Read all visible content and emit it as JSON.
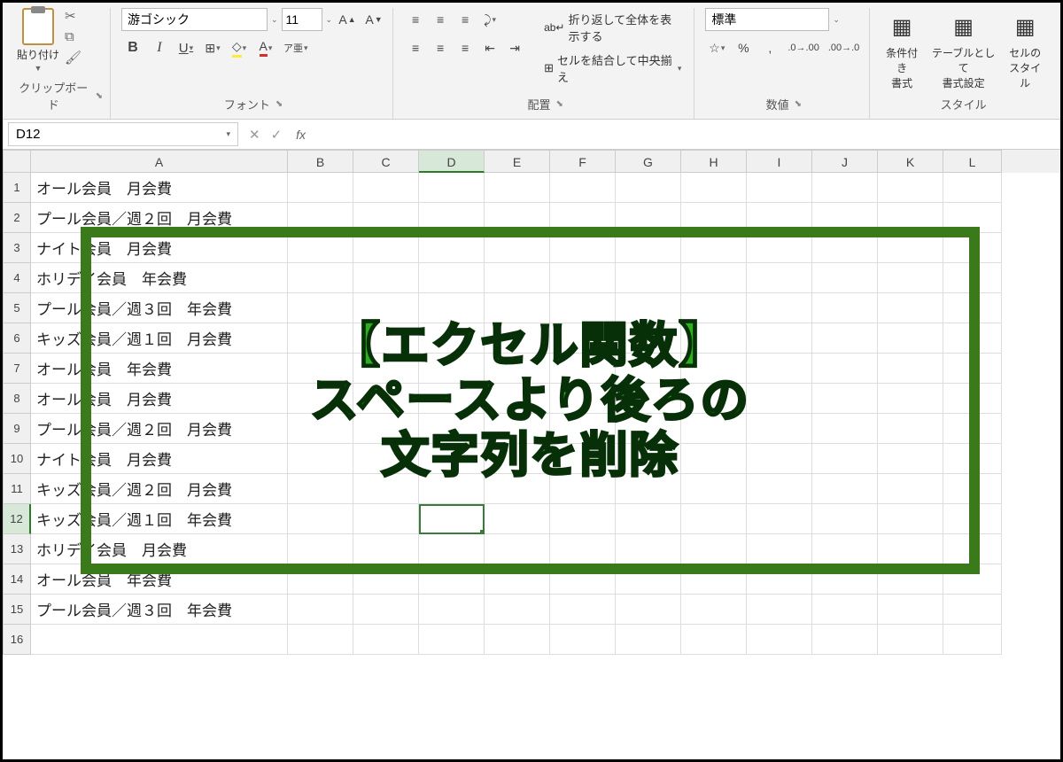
{
  "ribbon": {
    "clipboard": {
      "paste": "貼り付け",
      "label": "クリップボード"
    },
    "font": {
      "name": "游ゴシック",
      "size": "11",
      "label": "フォント",
      "bold": "B",
      "italic": "I",
      "underline": "U"
    },
    "alignment": {
      "label": "配置",
      "wrap": "折り返して全体を表示する",
      "merge": "セルを結合して中央揃え"
    },
    "number": {
      "format": "標準",
      "label": "数値"
    },
    "styles": {
      "cond": "条件付き\n書式",
      "table": "テーブルとして\n書式設定",
      "cell": "セルの\nスタイル",
      "label": "スタイル"
    }
  },
  "namebox": "D12",
  "columns": [
    "A",
    "B",
    "C",
    "D",
    "E",
    "F",
    "G",
    "H",
    "I",
    "J",
    "K",
    "L"
  ],
  "rows": [
    "オール会員　月会費",
    "プール会員／週２回　月会費",
    "ナイト会員　月会費",
    "ホリデイ会員　年会費",
    "プール会員／週３回　年会費",
    "キッズ会員／週１回　月会費",
    "オール会員　年会費",
    "オール会員　月会費",
    "プール会員／週２回　月会費",
    "ナイト会員　月会費",
    "キッズ会員／週２回　月会費",
    "キッズ会員／週１回　年会費",
    "ホリデイ会員　月会費",
    "オール会員　年会費",
    "プール会員／週３回　年会費",
    ""
  ],
  "overlay": {
    "line1": "【エクセル関数】",
    "line2": "スペースより後ろの",
    "line3": "文字列を削除"
  },
  "selected_row": 12,
  "selected_col": "D"
}
